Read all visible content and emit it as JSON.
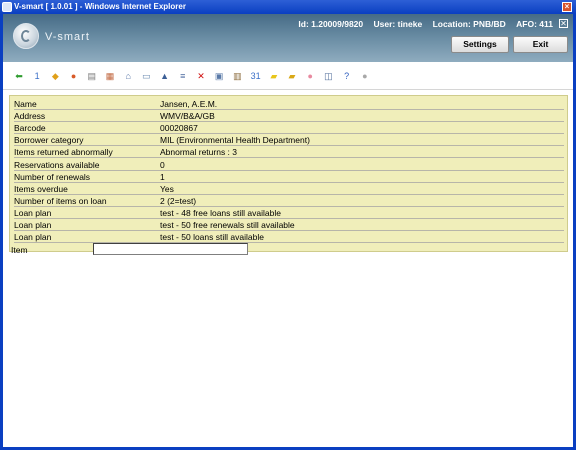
{
  "window": {
    "title": "V-smart [ 1.0.01 ] - Windows Internet Explorer"
  },
  "header": {
    "logo_text": "V-smart",
    "id_label": "Id: 1.20009/9820",
    "user_label": "User: tineke",
    "location_label": "Location: PNB/BD",
    "afo_label": "AFO: 411",
    "close_glyph": "✕",
    "settings_label": "Settings",
    "exit_label": "Exit"
  },
  "toolbar": {
    "icons": [
      {
        "name": "back-arrow-icon",
        "glyph": "⬅",
        "color": "#2e9b2e"
      },
      {
        "name": "calendar-one-icon",
        "glyph": "1",
        "color": "#3a6fc7"
      },
      {
        "name": "tag-icon",
        "glyph": "◆",
        "color": "#e0a01a"
      },
      {
        "name": "users-icon",
        "glyph": "●",
        "color": "#d85a28"
      },
      {
        "name": "printer-icon",
        "glyph": "▤",
        "color": "#7a7a7a"
      },
      {
        "name": "books-icon",
        "glyph": "▦",
        "color": "#c0643c"
      },
      {
        "name": "home-icon",
        "glyph": "⌂",
        "color": "#5a78a8"
      },
      {
        "name": "card-icon",
        "glyph": "▭",
        "color": "#6a8ab0"
      },
      {
        "name": "stamp-icon",
        "glyph": "▲",
        "color": "#3c5f96"
      },
      {
        "name": "document-list-icon",
        "glyph": "≡",
        "color": "#4b6aa0"
      },
      {
        "name": "delete-icon",
        "glyph": "✕",
        "color": "#d01010"
      },
      {
        "name": "print-preview-icon",
        "glyph": "▣",
        "color": "#5a7aa8"
      },
      {
        "name": "clipboard-icon",
        "glyph": "▥",
        "color": "#8a6a3a"
      },
      {
        "name": "calendar-31-icon",
        "glyph": "31",
        "color": "#3a6fc7"
      },
      {
        "name": "note-icon",
        "glyph": "▰",
        "color": "#e8c61a"
      },
      {
        "name": "notes-stack-icon",
        "glyph": "▰",
        "color": "#d9a816"
      },
      {
        "name": "piggy-bank-icon",
        "glyph": "●",
        "color": "#e88aa0"
      },
      {
        "name": "view-icon",
        "glyph": "◫",
        "color": "#4f6c9a"
      },
      {
        "name": "help-icon",
        "glyph": "?",
        "color": "#2b5bbd"
      },
      {
        "name": "user-group-icon",
        "glyph": "●",
        "color": "#a8a8a8"
      }
    ]
  },
  "details": [
    {
      "label": "Name",
      "value": "Jansen, A.E.M."
    },
    {
      "label": "Address",
      "value": "WMV/B&A/GB"
    },
    {
      "label": "Barcode",
      "value": "00020867"
    },
    {
      "label": "Borrower category",
      "value": "MIL (Environmental Health Department)"
    },
    {
      "label": "Items returned abnormally",
      "value": "Abnormal returns : 3"
    },
    {
      "label": "Reservations available",
      "value": "0"
    },
    {
      "label": "Number of renewals",
      "value": "1"
    },
    {
      "label": "Items overdue",
      "value": "Yes"
    },
    {
      "label": "Number of items on loan",
      "value": "2 (2=test)"
    },
    {
      "label": "Loan plan",
      "value": "test - 48 free loans still available"
    },
    {
      "label": "Loan plan",
      "value": "test - 50 free renewals still available"
    },
    {
      "label": "Loan plan",
      "value": "test - 50 loans still available"
    }
  ],
  "item_field": {
    "label": "Item",
    "value": ""
  }
}
